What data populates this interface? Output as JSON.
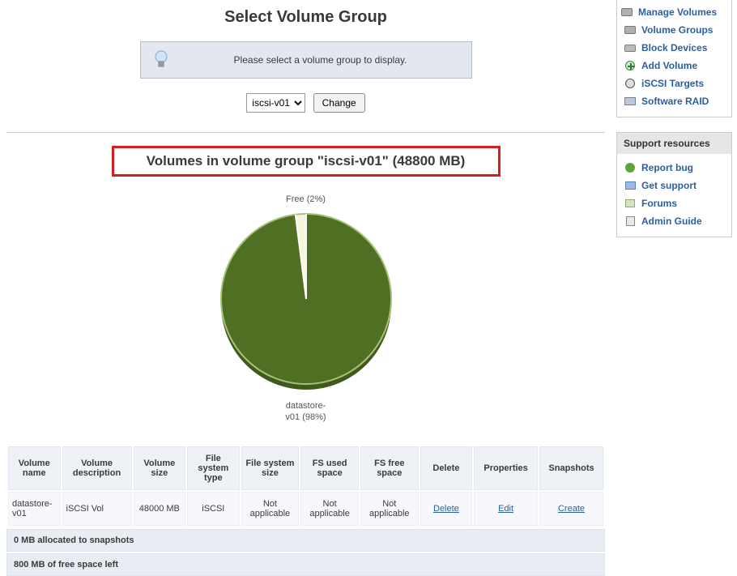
{
  "page": {
    "title": "Select Volume Group",
    "hint": "Please select a volume group to display.",
    "selector": {
      "selected": "iscsi-v01",
      "button": "Change"
    },
    "section_title": "Volumes in volume group \"iscsi-v01\" (48800 MB)"
  },
  "chart_data": {
    "type": "pie",
    "title": "",
    "series": [
      {
        "name": "Free",
        "value": 2
      },
      {
        "name": "datastore-v01",
        "value": 98
      }
    ],
    "labels": {
      "free": "Free (2%)",
      "used_line1": "datastore-",
      "used_line2": "v01 (98%)"
    },
    "colors": {
      "free": "#f4f7d9",
      "used": "#4f7023",
      "ring": "#a7c17a"
    }
  },
  "table": {
    "headers": [
      "Volume name",
      "Volume description",
      "Volume size",
      "File system type",
      "File system size",
      "FS used space",
      "FS free space",
      "Delete",
      "Properties",
      "Snapshots"
    ],
    "row": {
      "name": "datastore-v01",
      "desc": "iSCSI Vol",
      "size": "48000 MB",
      "fstype": "iSCSI",
      "fssize": "Not applicable",
      "fsused": "Not applicable",
      "fsfree": "Not applicable",
      "delete": "Delete",
      "props": "Edit",
      "snaps": "Create"
    },
    "footer1": "0 MB allocated to snapshots",
    "footer2": "800 MB of free space left"
  },
  "sidebar": {
    "volumes": {
      "header": "Manage Volumes",
      "items": [
        {
          "label": "Volume Groups",
          "icon": "disk-icon"
        },
        {
          "label": "Block Devices",
          "icon": "drive-icon"
        },
        {
          "label": "Add Volume",
          "icon": "plus-icon"
        },
        {
          "label": "iSCSI Targets",
          "icon": "target-icon"
        },
        {
          "label": "Software RAID",
          "icon": "raid-icon"
        }
      ]
    },
    "support": {
      "header": "Support resources",
      "items": [
        {
          "label": "Report bug",
          "icon": "bug-icon"
        },
        {
          "label": "Get support",
          "icon": "support-icon"
        },
        {
          "label": "Forums",
          "icon": "forum-icon"
        },
        {
          "label": "Admin Guide",
          "icon": "guide-icon"
        }
      ]
    }
  }
}
